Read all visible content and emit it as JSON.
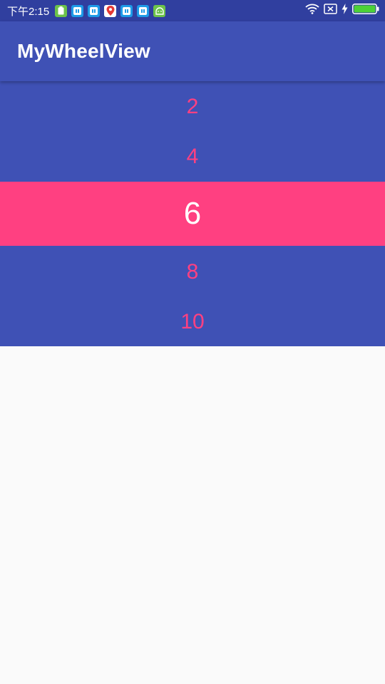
{
  "status_bar": {
    "time": "下午2:15",
    "notification_icons": [
      "battery-app-icon",
      "app-icon",
      "app-icon",
      "maps-icon",
      "app-icon",
      "app-icon",
      "android-icon"
    ],
    "status_icons": [
      "wifi-icon",
      "no-sim-icon",
      "charging-icon",
      "battery-icon"
    ],
    "background_color": "#303F9F"
  },
  "app_bar": {
    "title": "MyWheelView",
    "background_color": "#3F51B5"
  },
  "wheel": {
    "items": [
      "2",
      "4",
      "6",
      "8",
      "10"
    ],
    "selected_value": "6",
    "background_color": "#3F51B5",
    "accent_color": "#FF4081",
    "selected_text_color": "#FFFFFF"
  }
}
